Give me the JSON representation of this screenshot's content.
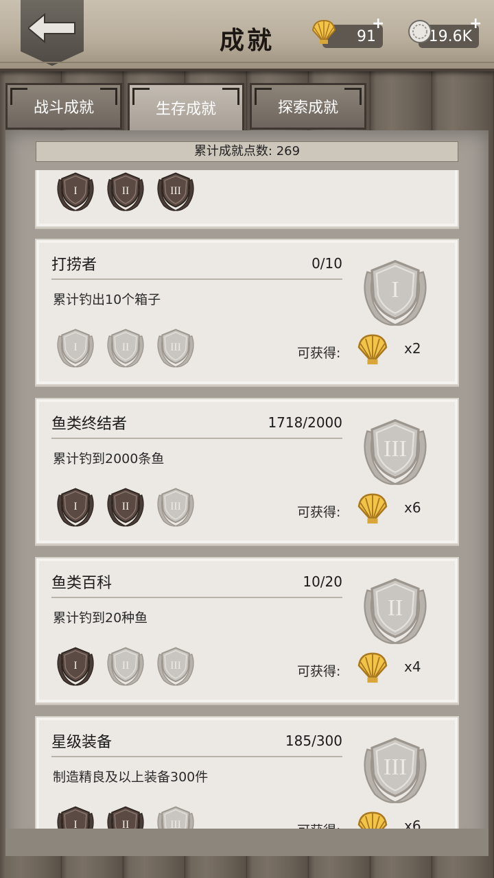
{
  "header": {
    "title": "成就",
    "shell_amount": "91",
    "coin_amount": "19.6K",
    "plus": "+"
  },
  "tabs": [
    {
      "label": "战斗成就",
      "active": false
    },
    {
      "label": "生存成就",
      "active": true
    },
    {
      "label": "探索成就",
      "active": false
    }
  ],
  "total_points": "累计成就点数: 269",
  "reward_label": "可获得:",
  "achievements": [
    {
      "name": "打捞者",
      "progress": "0/10",
      "desc": "累计钓出10个箱子",
      "reward": "x2",
      "big_medal": "I",
      "earned": 0
    },
    {
      "name": "鱼类终结者",
      "progress": "1718/2000",
      "desc": "累计钓到2000条鱼",
      "reward": "x6",
      "big_medal": "III",
      "earned": 2
    },
    {
      "name": "鱼类百科",
      "progress": "10/20",
      "desc": "累计钓到20种鱼",
      "reward": "x4",
      "big_medal": "II",
      "earned": 1
    },
    {
      "name": "星级装备",
      "progress": "185/300",
      "desc": "制造精良及以上装备300件",
      "reward": "x6",
      "big_medal": "III",
      "earned": 2
    }
  ],
  "top_partial_card": {
    "earned": 3
  },
  "roman": [
    "I",
    "II",
    "III"
  ],
  "colors": {
    "earned_medal": "#5b4a44",
    "unearned_medal": "#c9c5c0",
    "shell_gold": "#f2c44a"
  }
}
